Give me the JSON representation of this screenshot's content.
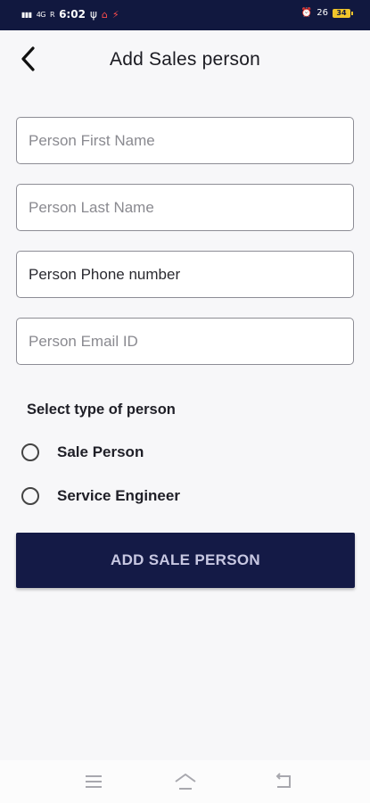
{
  "status_bar": {
    "signal_left": "4G",
    "signal_right": "R",
    "time": "6:02",
    "network_speed": "26",
    "battery": "34"
  },
  "header": {
    "title": "Add Sales person"
  },
  "form": {
    "first_name": {
      "placeholder": "Person First Name",
      "value": ""
    },
    "last_name": {
      "placeholder": "Person Last Name",
      "value": ""
    },
    "phone": {
      "placeholder": "Person Phone number",
      "value": ""
    },
    "email": {
      "placeholder": "Person Email ID",
      "value": ""
    }
  },
  "person_type": {
    "label": "Select type of person",
    "options": [
      {
        "label": "Sale Person",
        "selected": false
      },
      {
        "label": "Service Engineer",
        "selected": false
      }
    ]
  },
  "submit_label": "ADD SALE  PERSON",
  "colors": {
    "primary": "#141a46",
    "status_bar": "#11183f",
    "button_text": "#c8c8e2",
    "battery": "#f0c52b"
  }
}
